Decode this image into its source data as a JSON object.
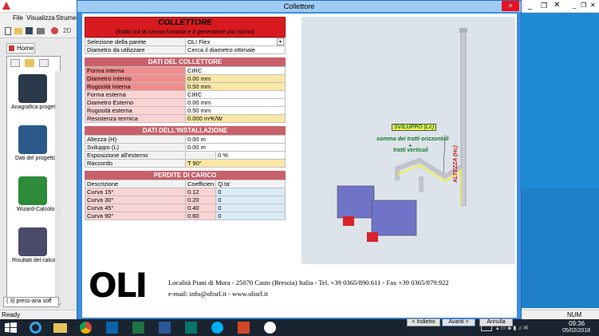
{
  "app": {
    "menu": [
      "File",
      "Visualizza",
      "Strumen"
    ],
    "toolbar_text": "2D",
    "tab_home": "Home",
    "sidebar_items": [
      "Anagrafica progett",
      "Dati del progetto",
      "Wizard-Calcolo",
      "Risultati del calco"
    ],
    "bottom_tab": "( 3) press-aria soff",
    "status_left": "Ready",
    "status_num": "NUM",
    "clock_time": "09:36",
    "clock_date": "05/02/2018"
  },
  "dialog": {
    "title": "Collettore",
    "close": "×",
    "header_title": "COLLETTORE",
    "header_subtitle": "(tratto tra la canna fumaria e il generatore più vicino)",
    "selezione_label": "Selezione della parete",
    "selezione_value": "OLI Flex",
    "diametro_label": "Diametro da utilizzare",
    "diametro_value": "Cerca il diametro ottimale",
    "sec_collettore": "DATI DEL COLLETTORE",
    "collettore_rows": [
      {
        "label": "Forma interna",
        "value": "CIRC",
        "lc": "lbl-red",
        "vc": "val-w"
      },
      {
        "label": "Diametro Interno",
        "value": "0.00 mm",
        "lc": "lbl-red",
        "vc": "val-y"
      },
      {
        "label": "Rugosità interna",
        "value": "0.50 mm",
        "lc": "lbl-red",
        "vc": "val-y"
      },
      {
        "label": "Forma esterna",
        "value": "CIRC",
        "lc": "lbl-pink",
        "vc": "val-w"
      },
      {
        "label": "Diametro Esterno",
        "value": "0.00 mm",
        "lc": "lbl-pink",
        "vc": "val-w"
      },
      {
        "label": "Rugosità esterna",
        "value": "0.50 mm",
        "lc": "lbl-pink",
        "vc": "val-w"
      },
      {
        "label": "Resistenza termica",
        "value": "0.000 m²K/W",
        "lc": "lbl-pink",
        "vc": "val-y"
      }
    ],
    "sec_installazione": "DATI DELL'INSTALLAZIONE",
    "installazione_rows": [
      {
        "label": "Altezza (H)",
        "value": "0.00 m",
        "vc": "val-w"
      },
      {
        "label": "Sviluppo (L)",
        "value": "0.00 m",
        "vc": "val-w"
      },
      {
        "label": "Esposizione all'esterno",
        "value": "0 %",
        "vc": "val-w"
      },
      {
        "label": "Raccordo",
        "value": "T 90°",
        "vc": "val-y"
      }
    ],
    "sec_perdite": "PERDITE DI CARICO",
    "perdite_header": [
      "Descrizione",
      "Coefficien",
      "Q.ta'"
    ],
    "perdite_rows": [
      {
        "desc": "Curva 15°",
        "coef": "0.12",
        "qta": "0"
      },
      {
        "desc": "Curva 30°",
        "coef": "0.20",
        "qta": "0"
      },
      {
        "desc": "Curva 45°",
        "coef": "0.40",
        "qta": "0"
      },
      {
        "desc": "Curva 90°",
        "coef": "0.60",
        "qta": "0"
      }
    ],
    "diagram": {
      "sviluppo_label": "SVILUPPO (Lc)",
      "somma_label": "somma dei tratti orizzontali",
      "plus": "+",
      "tratti_label": "tratti verticali",
      "altezza_label": "ALTEZZA (Hc)"
    },
    "footer": {
      "logo": "OLI",
      "address": "Località Piani di Mura - 25070 Casto (Brescia) Italia - Tel. +39 0365/890.611 - Fax +39 0365/879.922",
      "contacts": "e-mail: info@olisrl.it - www.olisrl.it"
    },
    "buttons": {
      "indietro": "< Indietro",
      "avanti": "Avanti >",
      "annulla": "Annulla"
    }
  },
  "colors": {
    "section": "#c8606b",
    "dialog_frame": "#3a8ee0",
    "taskbar": "#1a2430"
  }
}
